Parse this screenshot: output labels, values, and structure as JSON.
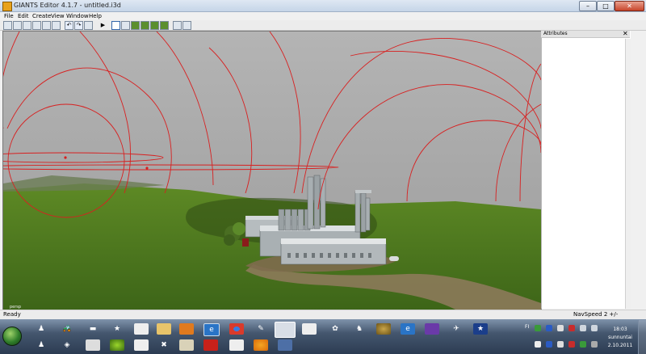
{
  "window": {
    "title": "GIANTS Editor 4.1.7 - untitled.i3d",
    "minimize": "–",
    "maximize": "□",
    "close": "✕"
  },
  "menu": [
    {
      "label": "File"
    },
    {
      "label": "Edit"
    },
    {
      "label": "Create"
    },
    {
      "label": "View"
    },
    {
      "label": "Window"
    },
    {
      "label": "Help"
    }
  ],
  "toolbar": {
    "buttons": [
      "new-icon",
      "open-icon",
      "save-icon",
      "import-icon",
      "export-icon",
      "save-all-icon",
      "undo-icon",
      "redo-icon",
      "refresh-icon",
      "play-icon",
      "select-icon",
      "move-icon",
      "terrain-raise-icon",
      "terrain-lower-icon",
      "terrain-smooth-icon",
      "terrain-paint-icon",
      "settings-icon",
      "camera-icon"
    ]
  },
  "viewport": {
    "label": "persp"
  },
  "attributes": {
    "title": "Attributes",
    "close": "✕"
  },
  "status": {
    "left": "Ready",
    "right": "NavSpeed 2 +/-"
  },
  "taskbar": {
    "tray_label": "FI",
    "clock": {
      "time": "18:03",
      "day": "sunnuntai",
      "date": "2.10.2011"
    }
  },
  "colors": {
    "sky": "#a3a3a3",
    "grass": "#4b7520",
    "dirt": "#8c7a5a",
    "gizmo": "#d82020"
  }
}
